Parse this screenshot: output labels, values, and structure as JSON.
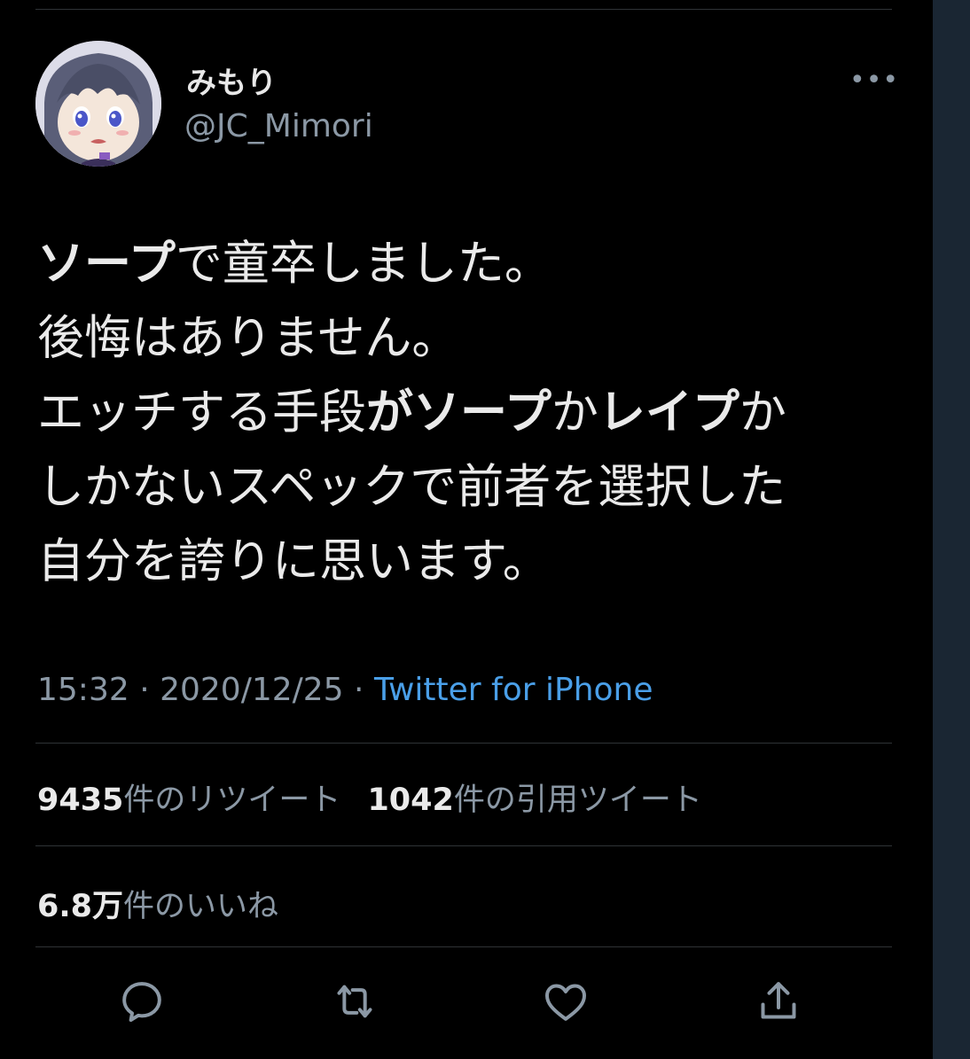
{
  "user": {
    "display_name": "みもり",
    "handle": "@JC_Mimori"
  },
  "tweet": {
    "lines": [
      [
        {
          "t": "ソープ",
          "b": true
        },
        {
          "t": "で童卒しました。",
          "b": false
        }
      ],
      [
        {
          "t": "後悔はありません。",
          "b": false
        }
      ],
      [
        {
          "t": "エッチする手段",
          "b": false
        },
        {
          "t": "がソープ",
          "b": true
        },
        {
          "t": "か",
          "b": false
        },
        {
          "t": "レイプ",
          "b": true
        },
        {
          "t": "か",
          "b": false
        }
      ],
      [
        {
          "t": "しかないスペックで前者を選択した",
          "b": false
        }
      ],
      [
        {
          "t": "自分を誇りに思います。",
          "b": false
        }
      ]
    ],
    "time": "15:32",
    "separator": " · ",
    "date": "2020/12/25",
    "source": "Twitter for iPhone"
  },
  "stats": {
    "retweets": {
      "num": "9435",
      "label": "件のリツイート"
    },
    "quotes": {
      "num": "1042",
      "label": "件の引用ツイート"
    },
    "likes": {
      "num": "6.8万",
      "label": "件のいいね"
    }
  },
  "icons": {
    "more": "more-icon",
    "reply": "reply-icon",
    "retweet": "retweet-icon",
    "like": "heart-icon",
    "share": "share-icon"
  },
  "colors": {
    "background": "#000000",
    "text": "#e8e8e8",
    "secondary": "#8b98a5",
    "link": "#4a9fe8",
    "divider": "#2f3336",
    "side_strip": "#1a2633"
  }
}
